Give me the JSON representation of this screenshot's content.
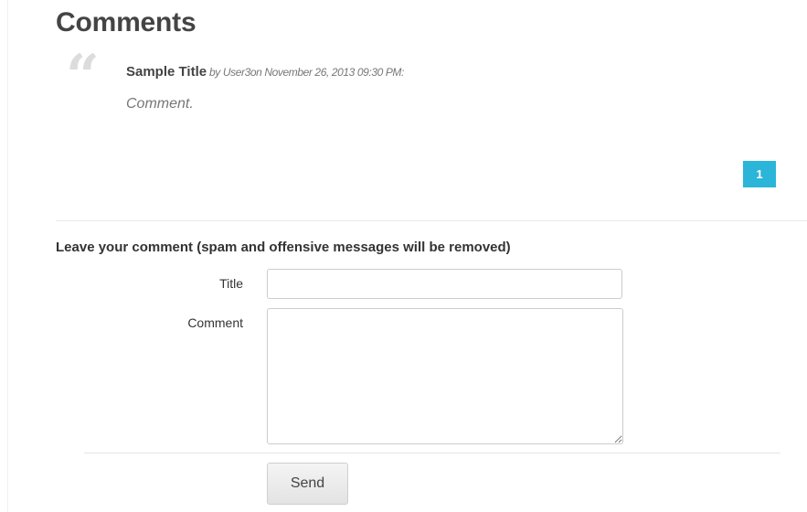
{
  "comments_section": {
    "heading": "Comments",
    "quote_glyph": "“",
    "comment": {
      "title": "Sample Title",
      "byline": " by User3on November 26, 2013 09:30 PM:",
      "body": "Comment."
    },
    "pagination": {
      "current_page": "1",
      "badge_color": "#2bb5d8"
    }
  },
  "comment_form": {
    "heading": "Leave your comment (spam and offensive messages will be removed)",
    "title_label": "Title",
    "title_value": "",
    "comment_label": "Comment",
    "comment_value": "",
    "send_label": "Send"
  }
}
